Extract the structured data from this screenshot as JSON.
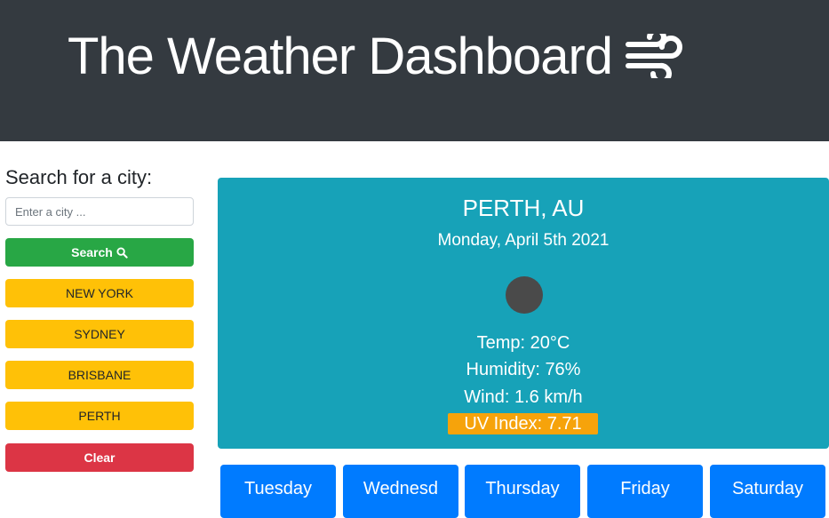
{
  "header": {
    "title": "The Weather Dashboard",
    "icon": "wind-icon"
  },
  "sidebar": {
    "heading": "Search for a city:",
    "search_placeholder": "Enter a city ...",
    "search_label": "Search",
    "search_icon": "search-icon",
    "cities": [
      "NEW YORK",
      "SYDNEY",
      "BRISBANE",
      "PERTH"
    ],
    "clear_label": "Clear"
  },
  "current": {
    "city": "PERTH, AU",
    "date": "Monday, April 5th 2021",
    "temp": "Temp: 20°C",
    "humidity": "Humidity: 76%",
    "wind": "Wind: 1.6 km/h",
    "uv": "UV Index: 7.71"
  },
  "forecast": {
    "days": [
      "Tuesday",
      "Wednesd",
      "Thursday",
      "Friday",
      "Saturday"
    ]
  },
  "colors": {
    "header_bg": "#343a40",
    "current_bg": "#17a2b8",
    "search_btn": "#28a745",
    "city_btn": "#ffc107",
    "clear_btn": "#dc3545",
    "forecast_bg": "#007bff",
    "uv_badge": "#f6a30b"
  }
}
